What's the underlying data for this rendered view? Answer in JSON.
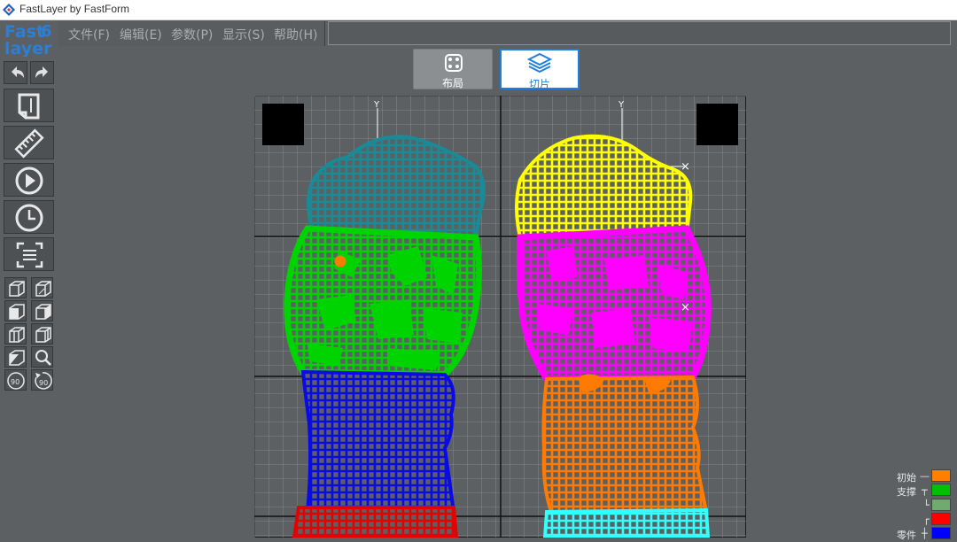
{
  "app": {
    "title": "FastLayer by FastForm"
  },
  "menu": {
    "items": [
      {
        "label": "文件(F)"
      },
      {
        "label": "编辑(E)"
      },
      {
        "label": "参数(P)"
      },
      {
        "label": "显示(S)"
      },
      {
        "label": "帮助(H)"
      }
    ]
  },
  "modes": {
    "layout_label": "布局",
    "slice_label": "切片",
    "active": "切片"
  },
  "viewport": {
    "axis_label_left": "Y",
    "axis_label_right": "Y",
    "marker_symbol": "×"
  },
  "legend": {
    "items": [
      {
        "label": "初始",
        "color": "#ff8000"
      },
      {
        "label": "支撑",
        "color": "#00c000"
      },
      {
        "label": "",
        "color": "#6faa6f"
      },
      {
        "label": "",
        "color": "#ff0000"
      },
      {
        "label": "零件",
        "color": "#0000ff"
      }
    ]
  },
  "colors": {
    "background": "#5c6063",
    "accent": "#1f7fe0",
    "teal": "#1a8a96",
    "green": "#00d400",
    "blue": "#0a0ae6",
    "red": "#e60000",
    "yellow": "#ffff00",
    "magenta": "#ff00ff",
    "orange": "#ff7a00",
    "cyan": "#33ffff"
  }
}
